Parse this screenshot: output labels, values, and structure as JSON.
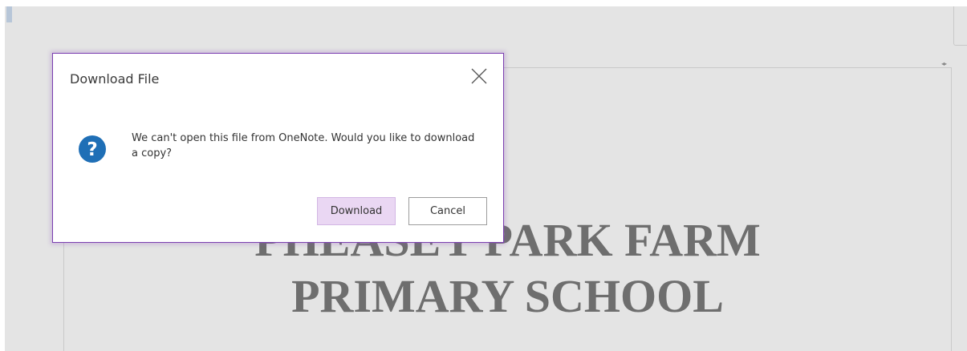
{
  "document": {
    "heading_line1": "PHEASEY PARK FARM",
    "heading_line2": "PRIMARY SCHOOL"
  },
  "dialog": {
    "title": "Download File",
    "close_icon": "close-icon",
    "message_icon": "question-icon",
    "message": "We can't open this file from OneNote. Would you like to download a copy?",
    "download_label": "Download",
    "cancel_label": "Cancel"
  },
  "colors": {
    "dialog_border": "#7b3fb0",
    "primary_button_bg": "#ead7f3",
    "question_icon": "#1f6fb6",
    "background": "#e4e4e4"
  }
}
